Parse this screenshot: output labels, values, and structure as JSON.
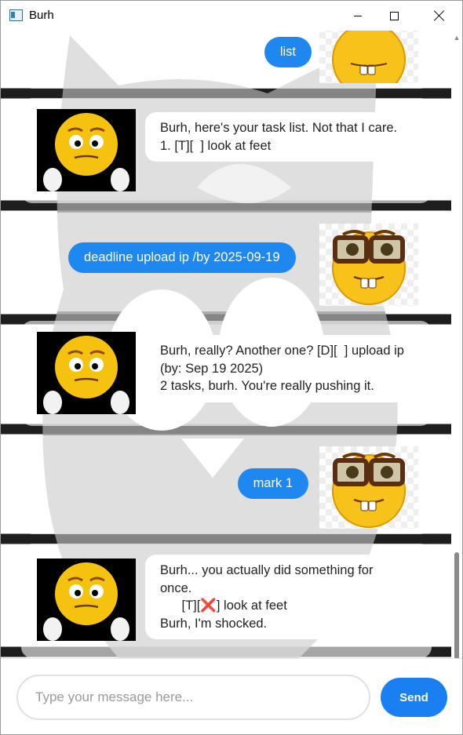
{
  "window": {
    "title": "Burh"
  },
  "messages": [
    {
      "sender": "user",
      "text": "list"
    },
    {
      "sender": "bot",
      "text": "Burh, here's your task list. Not that I care.\n1. [T][  ] look at feet"
    },
    {
      "sender": "user",
      "text": "deadline upload ip /by 2025-09-19"
    },
    {
      "sender": "bot",
      "text": "Burh, really? Another one? [D][  ] upload ip (by: Sep 19 2025)\n2 tasks, burh. You're really pushing it."
    },
    {
      "sender": "user",
      "text": "mark 1"
    },
    {
      "sender": "bot",
      "text": "Burh... you actually did something for once.\n      [T][❌] look at feet\nBurh, I'm shocked."
    }
  ],
  "input": {
    "placeholder": "Type your message here...",
    "value": ""
  },
  "send_button": {
    "label": "Send"
  },
  "icons": {
    "app": "app-window-icon",
    "minimize": "minimize-icon",
    "maximize": "maximize-icon",
    "close": "close-icon",
    "scroll_up": "scroll-up-arrow-icon",
    "scroll_down": "scroll-down-arrow-icon",
    "bot_avatar": "worried-emoji-avatar",
    "user_avatar": "nerd-emoji-avatar"
  },
  "colors": {
    "accent": "#1e87f0",
    "send_button": "#1a7ff0",
    "bubble_bot": "#ffffff",
    "bubble_user": "#1e87f0"
  }
}
